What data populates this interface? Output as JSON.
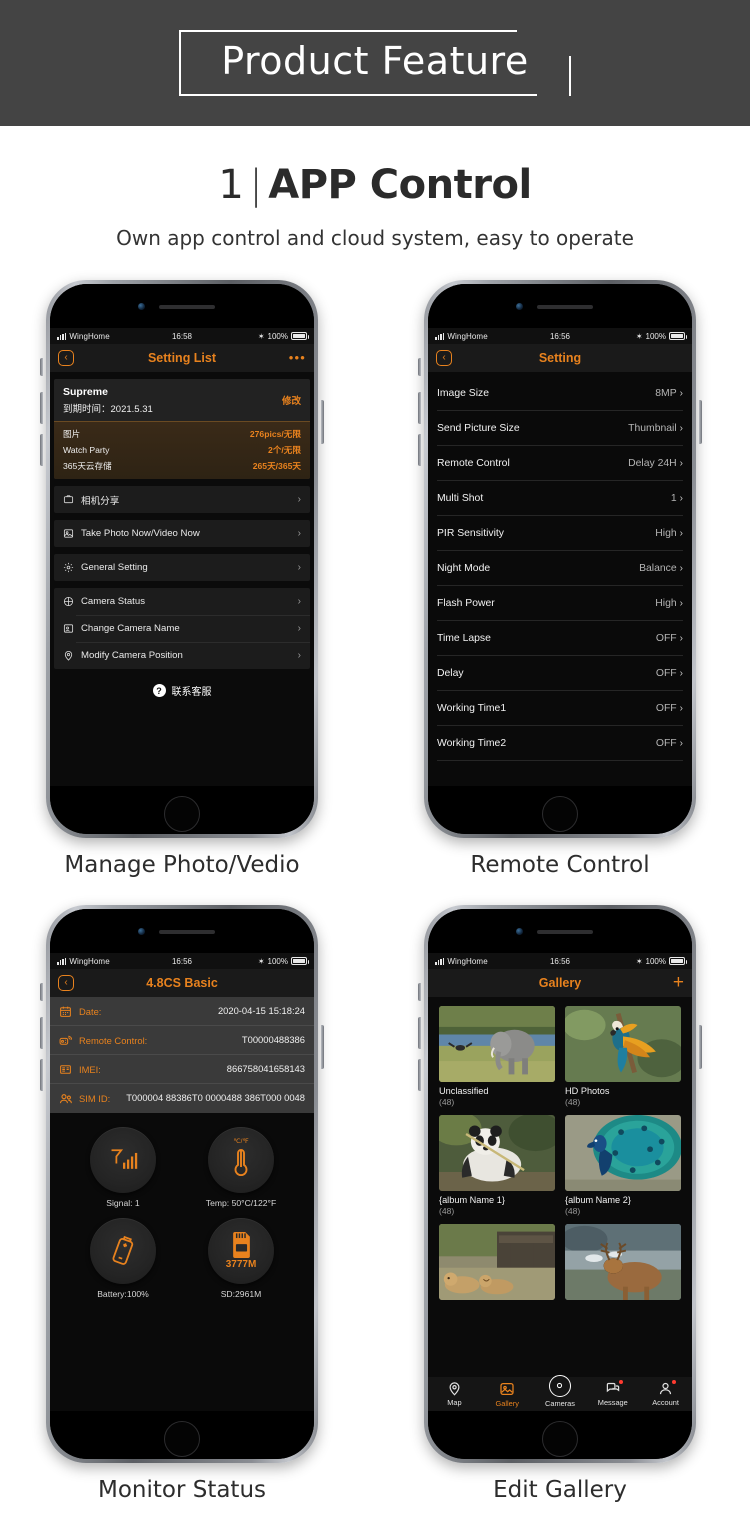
{
  "banner": {
    "title": "Product Feature"
  },
  "section": {
    "number": "1",
    "divider": "|",
    "title": "APP Control",
    "subtitle": "Own app control and cloud system, easy to operate"
  },
  "status_bar": {
    "carrier": "WingHome",
    "time_1": "16:58",
    "time_other": "16:56",
    "bluetooth": "✶",
    "battery": "100%"
  },
  "phones": [
    {
      "caption": "Manage Photo/Vedio",
      "nav": {
        "title": "Setting List",
        "back": "‹",
        "more": "•••"
      },
      "subscription": {
        "name": "Supreme",
        "expiry_label": "到期时间：",
        "expiry_value": "2021.5.31",
        "edit": "修改",
        "rows": [
          {
            "key": "图片",
            "value": "276pics/无限"
          },
          {
            "key": "Watch Party",
            "value": "2个/无限"
          },
          {
            "key": "365天云存储",
            "value": "265天/365天"
          }
        ]
      },
      "group_a": [
        {
          "icon": "share-camera-icon",
          "label": "相机分享"
        }
      ],
      "group_b": [
        {
          "icon": "photo-capture-icon",
          "label": "Take Photo Now/Video Now"
        }
      ],
      "group_c": [
        {
          "icon": "gear-icon",
          "label": "General Setting"
        }
      ],
      "group_d": [
        {
          "icon": "target-icon",
          "label": "Camera Status"
        },
        {
          "icon": "id-card-icon",
          "label": "Change Camera Name"
        },
        {
          "icon": "location-pin-icon",
          "label": "Modify Camera Position"
        }
      ],
      "support": {
        "icon": "question-icon",
        "label": "联系客服"
      }
    },
    {
      "caption": "Remote Control",
      "nav": {
        "title": "Setting",
        "back": "‹"
      },
      "settings": [
        {
          "label": "Image Size",
          "value": "8MP"
        },
        {
          "label": "Send Picture Size",
          "value": "Thumbnail"
        },
        {
          "label": "Remote Control",
          "value": "Delay 24H"
        },
        {
          "label": "Multi Shot",
          "value": "1"
        },
        {
          "label": "PIR Sensitivity",
          "value": "High"
        },
        {
          "label": "Night Mode",
          "value": "Balance"
        },
        {
          "label": "Flash Power",
          "value": "High"
        },
        {
          "label": "Time Lapse",
          "value": "OFF"
        },
        {
          "label": "Delay",
          "value": "OFF"
        },
        {
          "label": "Working Time1",
          "value": "OFF"
        },
        {
          "label": "Working Time2",
          "value": "OFF"
        }
      ]
    },
    {
      "caption": "Monitor Status",
      "nav": {
        "title": "4.8CS Basic",
        "back": "‹"
      },
      "info": [
        {
          "icon": "calendar-icon",
          "key": "Date:",
          "value": "2020-04-15 15:18:24"
        },
        {
          "icon": "remote-control-icon",
          "key": "Remote Control:",
          "value": "T00000488386"
        },
        {
          "icon": "sim-card-icon",
          "key": "IMEI:",
          "value": "866758041658143"
        },
        {
          "icon": "users-icon",
          "key": "SIM ID:",
          "value": "T000004 88386T0 0000488 386T000 0048"
        }
      ],
      "gauges": [
        {
          "icon": "signal-icon",
          "caption": "Signal: 1",
          "inner": ""
        },
        {
          "icon": "thermometer-icon",
          "caption": "Temp: 50°C/122°F",
          "inner": "℃/℉"
        },
        {
          "icon": "battery-icon",
          "caption": "Battery:100%",
          "inner": ""
        },
        {
          "icon": "sd-card-icon",
          "caption": "SD:2961M",
          "inner": "3777M"
        }
      ]
    },
    {
      "caption": "Edit Gallery",
      "nav": {
        "title": "Gallery",
        "add": "+"
      },
      "albums": [
        {
          "name": "Unclassified",
          "count": "(48)",
          "thumb": "elephant-thumbnail"
        },
        {
          "name": "HD Photos",
          "count": "(48)",
          "thumb": "macaw-thumbnail"
        },
        {
          "name": "{album Name 1}",
          "count": "(48)",
          "thumb": "panda-thumbnail"
        },
        {
          "name": "{album Name 2}",
          "count": "(48)",
          "thumb": "peacock-thumbnail"
        },
        {
          "name": "",
          "count": "",
          "thumb": "lions-thumbnail"
        },
        {
          "name": "",
          "count": "",
          "thumb": "deer-thumbnail"
        }
      ],
      "tabs": [
        {
          "label": "Map",
          "icon": "map-pin-icon",
          "active": false,
          "badge": false
        },
        {
          "label": "Gallery",
          "icon": "gallery-icon",
          "active": true,
          "badge": false
        },
        {
          "label": "Cameras",
          "icon": "camera-icon",
          "active": false,
          "badge": false
        },
        {
          "label": "Message",
          "icon": "message-icon",
          "active": false,
          "badge": true
        },
        {
          "label": "Account",
          "icon": "account-icon",
          "active": false,
          "badge": true
        }
      ]
    }
  ],
  "colors": {
    "accent": "#e8821e",
    "banner_bg": "#444444",
    "screen_bg": "#0b0b0b",
    "badge_red": "#ff3b30"
  }
}
